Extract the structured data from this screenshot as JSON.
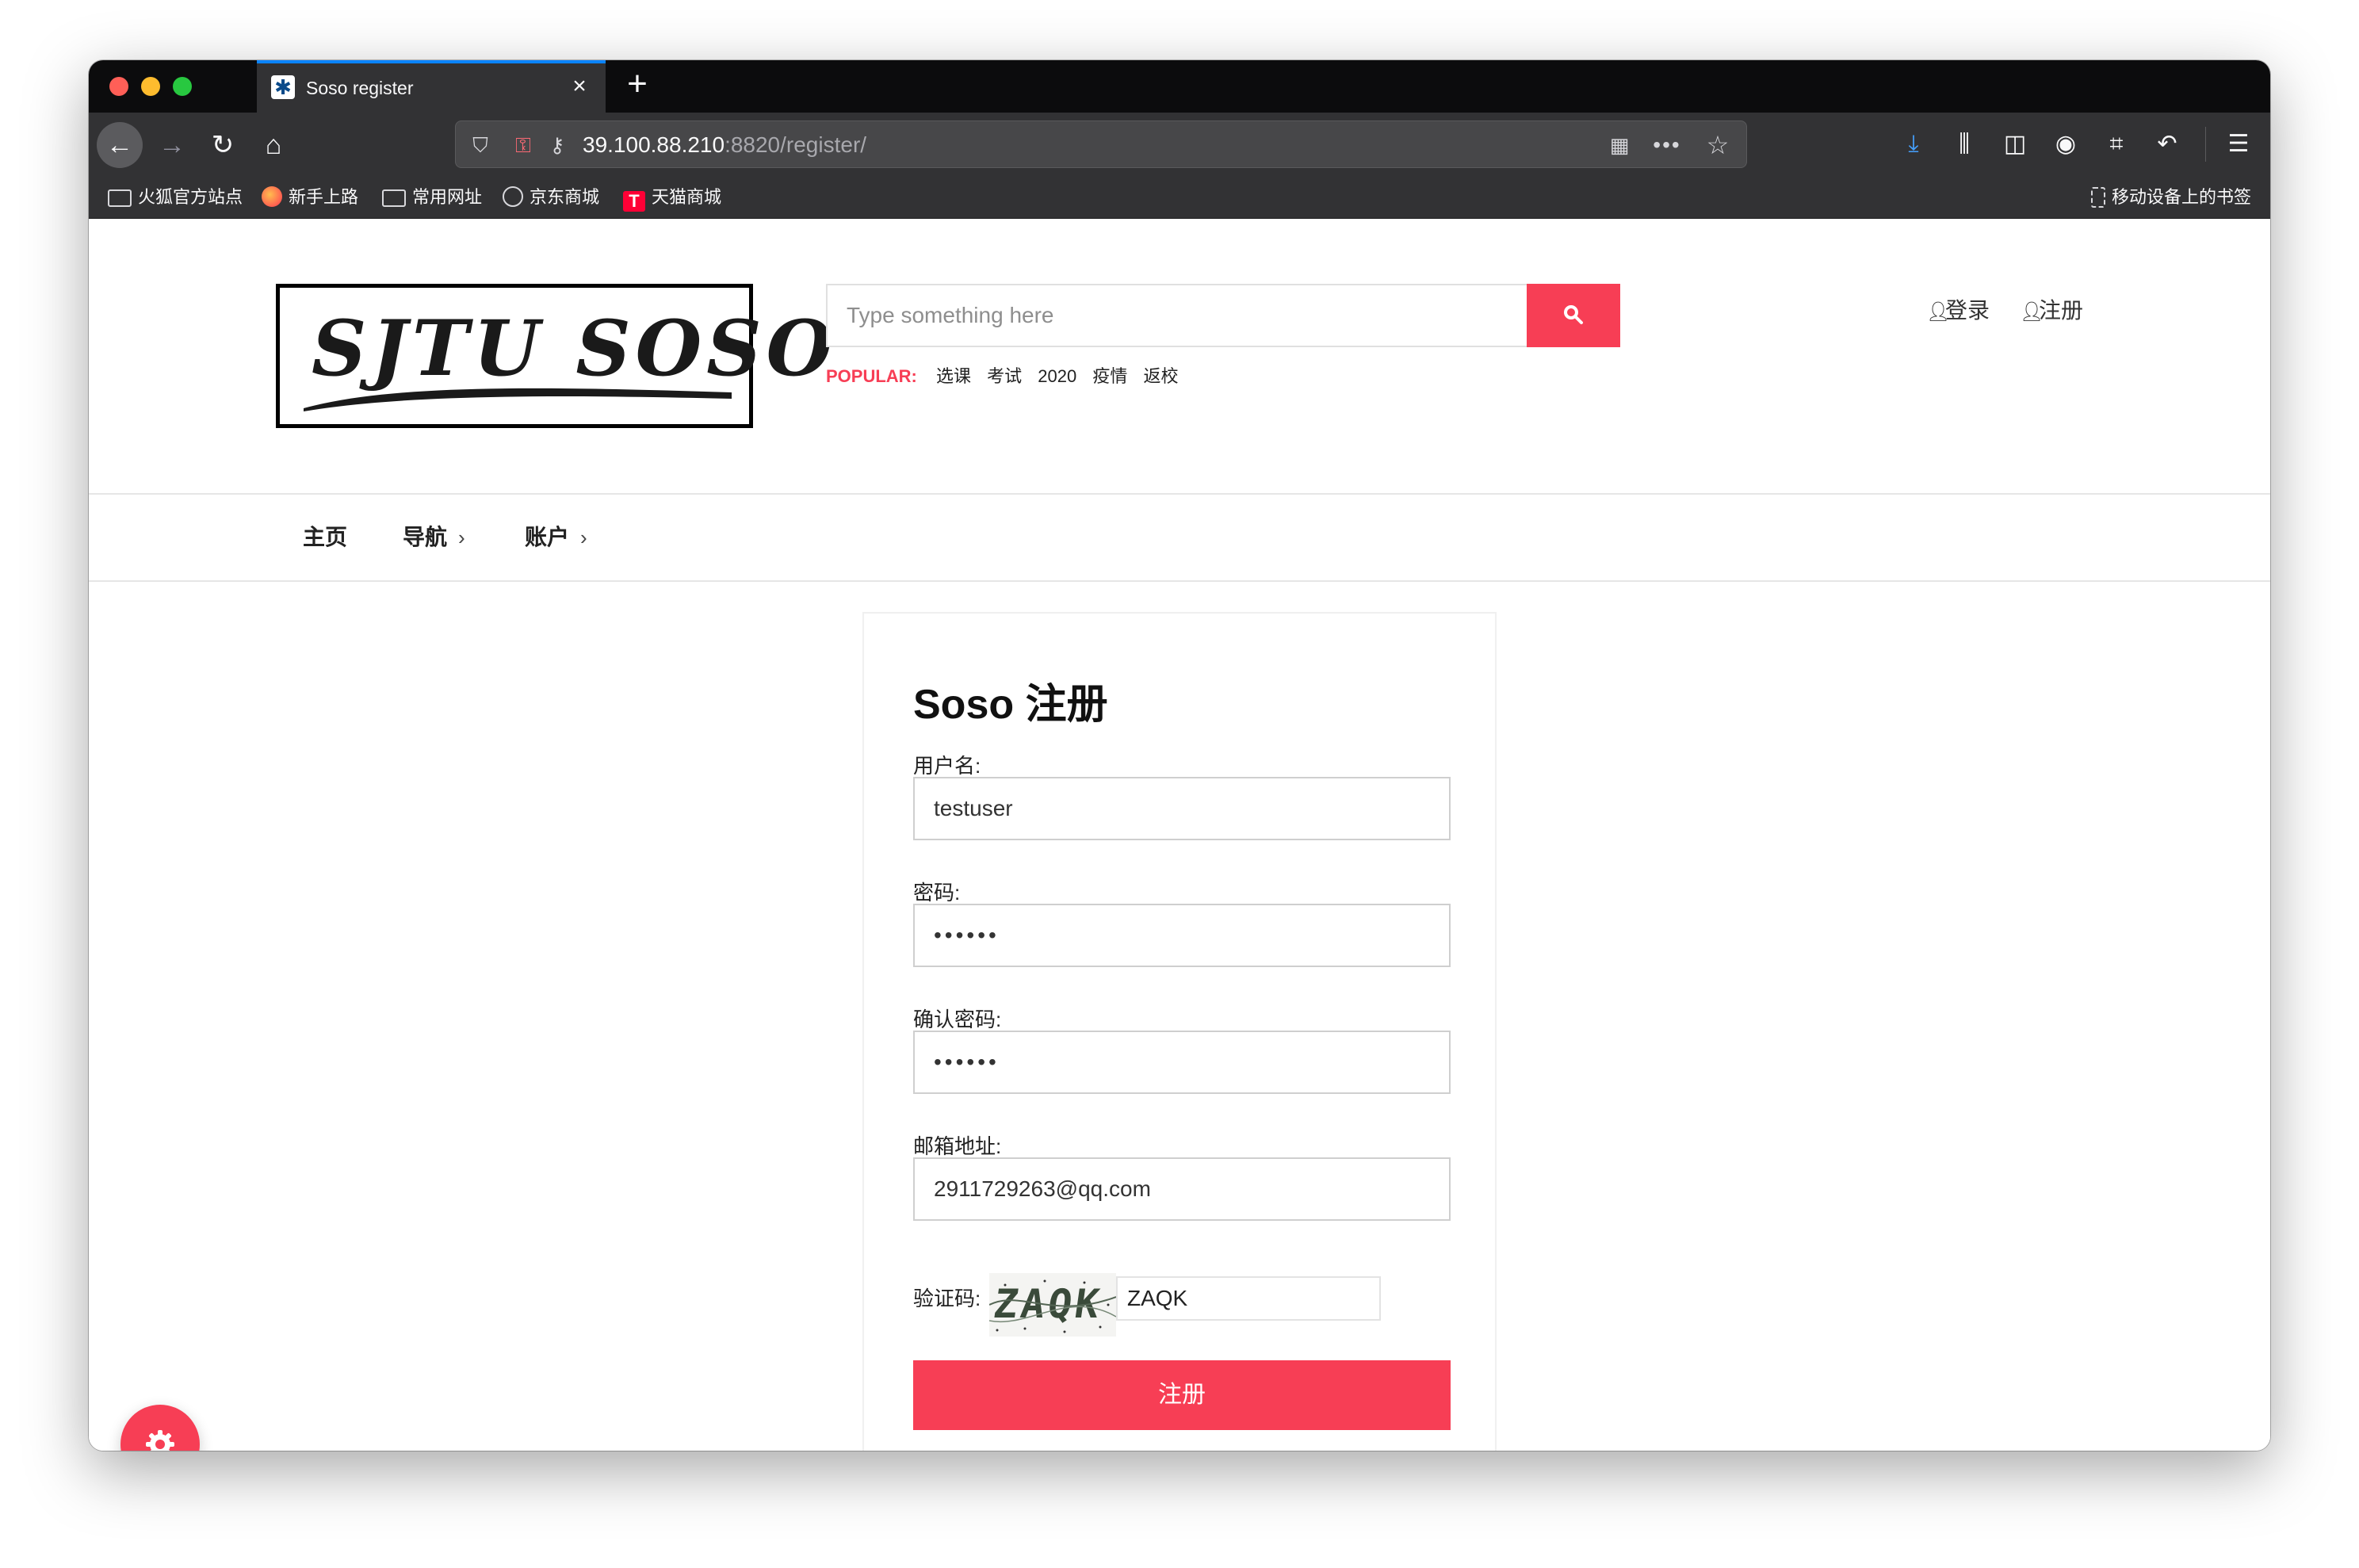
{
  "browser": {
    "tab": {
      "title": "Soso register"
    },
    "url": {
      "host": "39.100.88.210",
      "rest": ":8820/register/"
    },
    "bookmarks": [
      {
        "label": "火狐官方站点",
        "icon": "folder-icon"
      },
      {
        "label": "新手上路",
        "icon": "firefox-icon"
      },
      {
        "label": "常用网址",
        "icon": "folder-icon"
      },
      {
        "label": "京东商城",
        "icon": "globe-icon"
      },
      {
        "label": "天猫商城",
        "icon": "tmall-icon"
      }
    ],
    "mobile_bookmarks": "移动设备上的书签",
    "accent": "#0a84ff"
  },
  "site": {
    "logo_text": "SJTU SOSO",
    "search": {
      "placeholder": "Type something here"
    },
    "popular": {
      "label": "POPULAR:",
      "tags": [
        "选课",
        "考试",
        "2020",
        "疫情",
        "返校"
      ]
    },
    "auth": {
      "login": "登录",
      "register": "注册"
    },
    "menu": {
      "home": "主页",
      "nav": "导航",
      "account": "账户"
    },
    "brand_color": "#f73e55"
  },
  "form": {
    "title": "Soso 注册",
    "username": {
      "label": "用户名:",
      "value": "testuser"
    },
    "password": {
      "label": "密码:",
      "value": "••••••"
    },
    "confirm": {
      "label": "确认密码:",
      "value": "••••••"
    },
    "email": {
      "label": "邮箱地址:",
      "value": "2911729263@qq.com"
    },
    "captcha": {
      "label": "验证码:",
      "image_text": "ZAQK",
      "value": "ZAQK"
    },
    "submit_label": "注册"
  }
}
